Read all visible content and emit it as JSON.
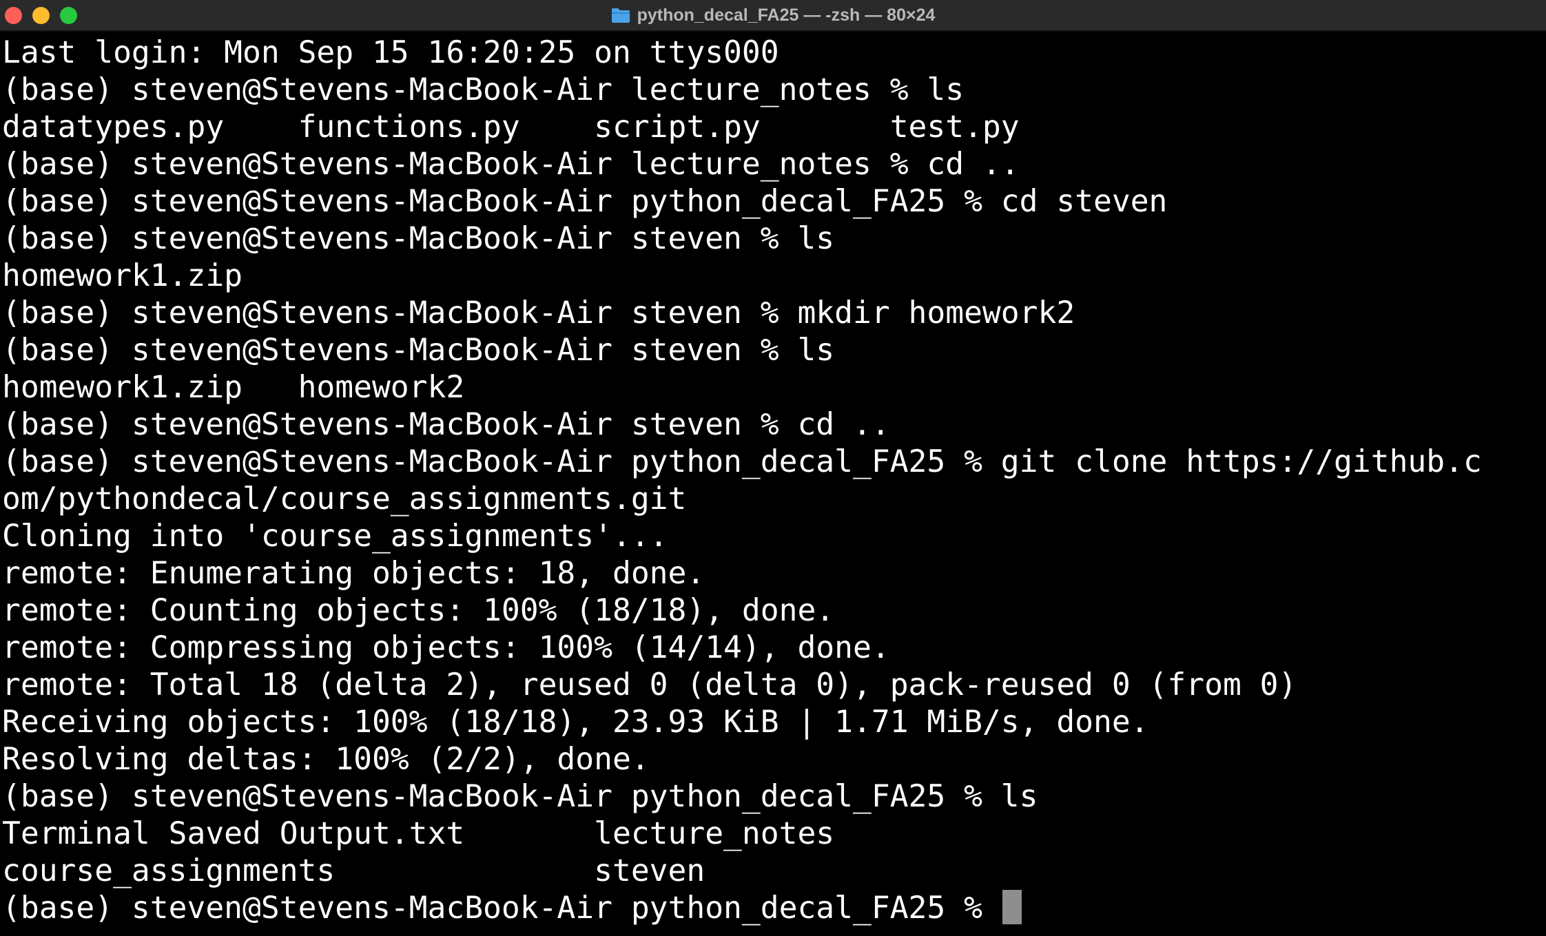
{
  "window": {
    "title": "python_decal_FA25 — -zsh — 80×24"
  },
  "terminal": {
    "lines": [
      "Last login: Mon Sep 15 16:20:25 on ttys000",
      "(base) steven@Stevens-MacBook-Air lecture_notes % ls",
      "datatypes.py    functions.py    script.py       test.py",
      "(base) steven@Stevens-MacBook-Air lecture_notes % cd ..",
      "(base) steven@Stevens-MacBook-Air python_decal_FA25 % cd steven",
      "(base) steven@Stevens-MacBook-Air steven % ls",
      "homework1.zip",
      "(base) steven@Stevens-MacBook-Air steven % mkdir homework2",
      "(base) steven@Stevens-MacBook-Air steven % ls",
      "homework1.zip   homework2",
      "(base) steven@Stevens-MacBook-Air steven % cd ..",
      "(base) steven@Stevens-MacBook-Air python_decal_FA25 % git clone https://github.c",
      "om/pythondecal/course_assignments.git",
      "Cloning into 'course_assignments'...",
      "remote: Enumerating objects: 18, done.",
      "remote: Counting objects: 100% (18/18), done.",
      "remote: Compressing objects: 100% (14/14), done.",
      "remote: Total 18 (delta 2), reused 0 (delta 0), pack-reused 0 (from 0)",
      "Receiving objects: 100% (18/18), 23.93 KiB | 1.71 MiB/s, done.",
      "Resolving deltas: 100% (2/2), done.",
      "(base) steven@Stevens-MacBook-Air python_decal_FA25 % ls",
      "Terminal Saved Output.txt       lecture_notes",
      "course_assignments              steven"
    ],
    "prompt": "(base) steven@Stevens-MacBook-Air python_decal_FA25 % "
  }
}
